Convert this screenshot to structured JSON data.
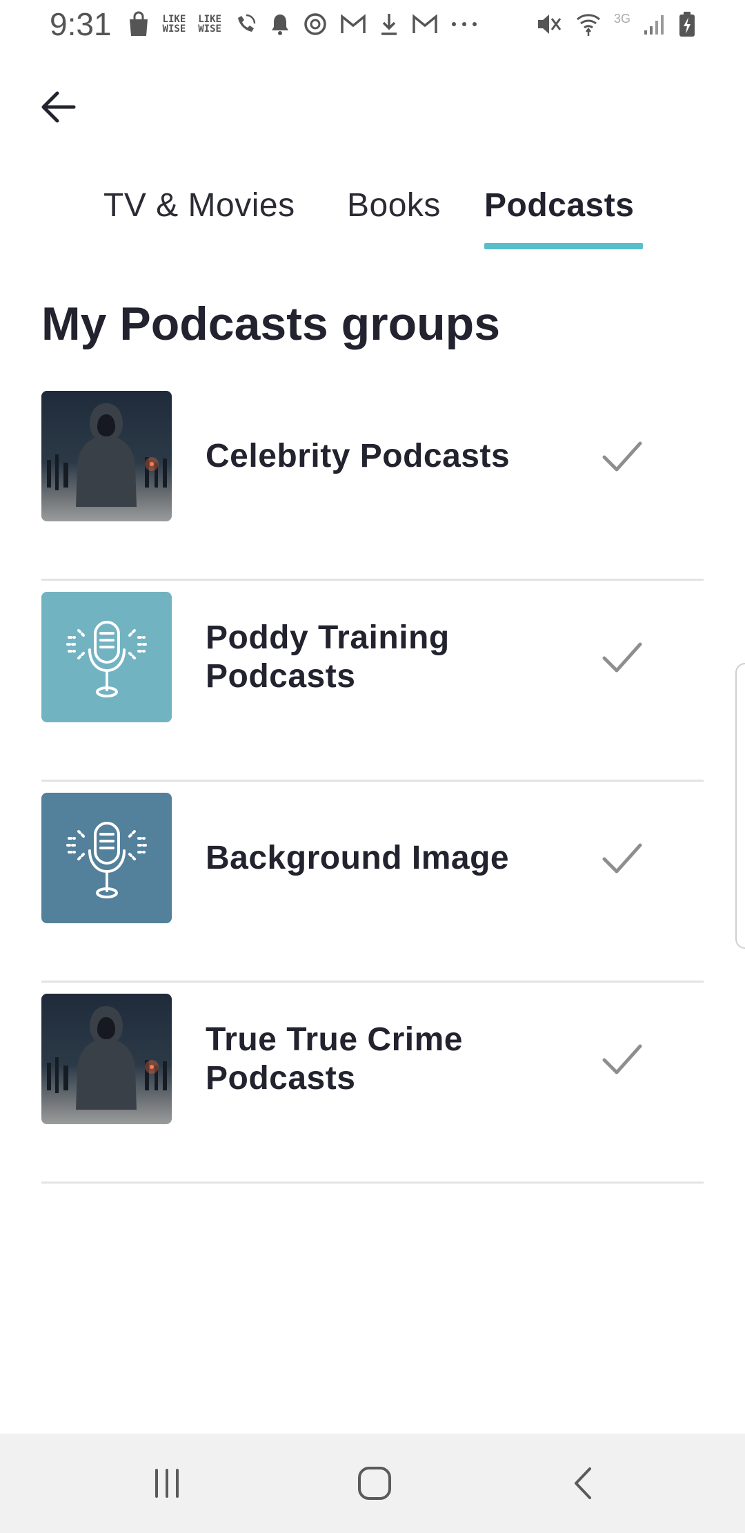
{
  "status_bar": {
    "time": "9:31",
    "left_icons": [
      "shopping-bag-icon",
      "likewise-icon",
      "likewise-icon",
      "wifi-call-icon",
      "bell-icon",
      "sync-icon",
      "gmail-icon",
      "download-icon",
      "gmail-icon",
      "more-icon"
    ],
    "likewise_label_line1": "LIKE",
    "likewise_label_line2": "WISE",
    "network_label": "3G",
    "right_icons": [
      "mute-icon",
      "wifi-icon",
      "signal-icon",
      "battery-charging-icon"
    ]
  },
  "header": {
    "back_icon": "arrow-left-icon"
  },
  "tabs": [
    {
      "label": "TV & Movies",
      "active": false
    },
    {
      "label": "Books",
      "active": false
    },
    {
      "label": "Podcasts",
      "active": true
    }
  ],
  "accent_color": "#58bec9",
  "section": {
    "title": "My Podcasts groups"
  },
  "groups": [
    {
      "name": "Celebrity Podcasts",
      "thumbnail": "hooded-figure-image",
      "checked": true
    },
    {
      "name": "Poddy Training Podcasts",
      "thumbnail": "microphone-icon",
      "thumbnail_color": "#72b3c2",
      "checked": true
    },
    {
      "name": "Background Image",
      "thumbnail": "microphone-icon",
      "thumbnail_color": "#53809b",
      "checked": true
    },
    {
      "name": "True True Crime Podcasts",
      "thumbnail": "hooded-figure-image",
      "checked": true
    }
  ],
  "nav_bar": {
    "icons": [
      "recents-icon",
      "home-icon",
      "back-icon"
    ]
  }
}
